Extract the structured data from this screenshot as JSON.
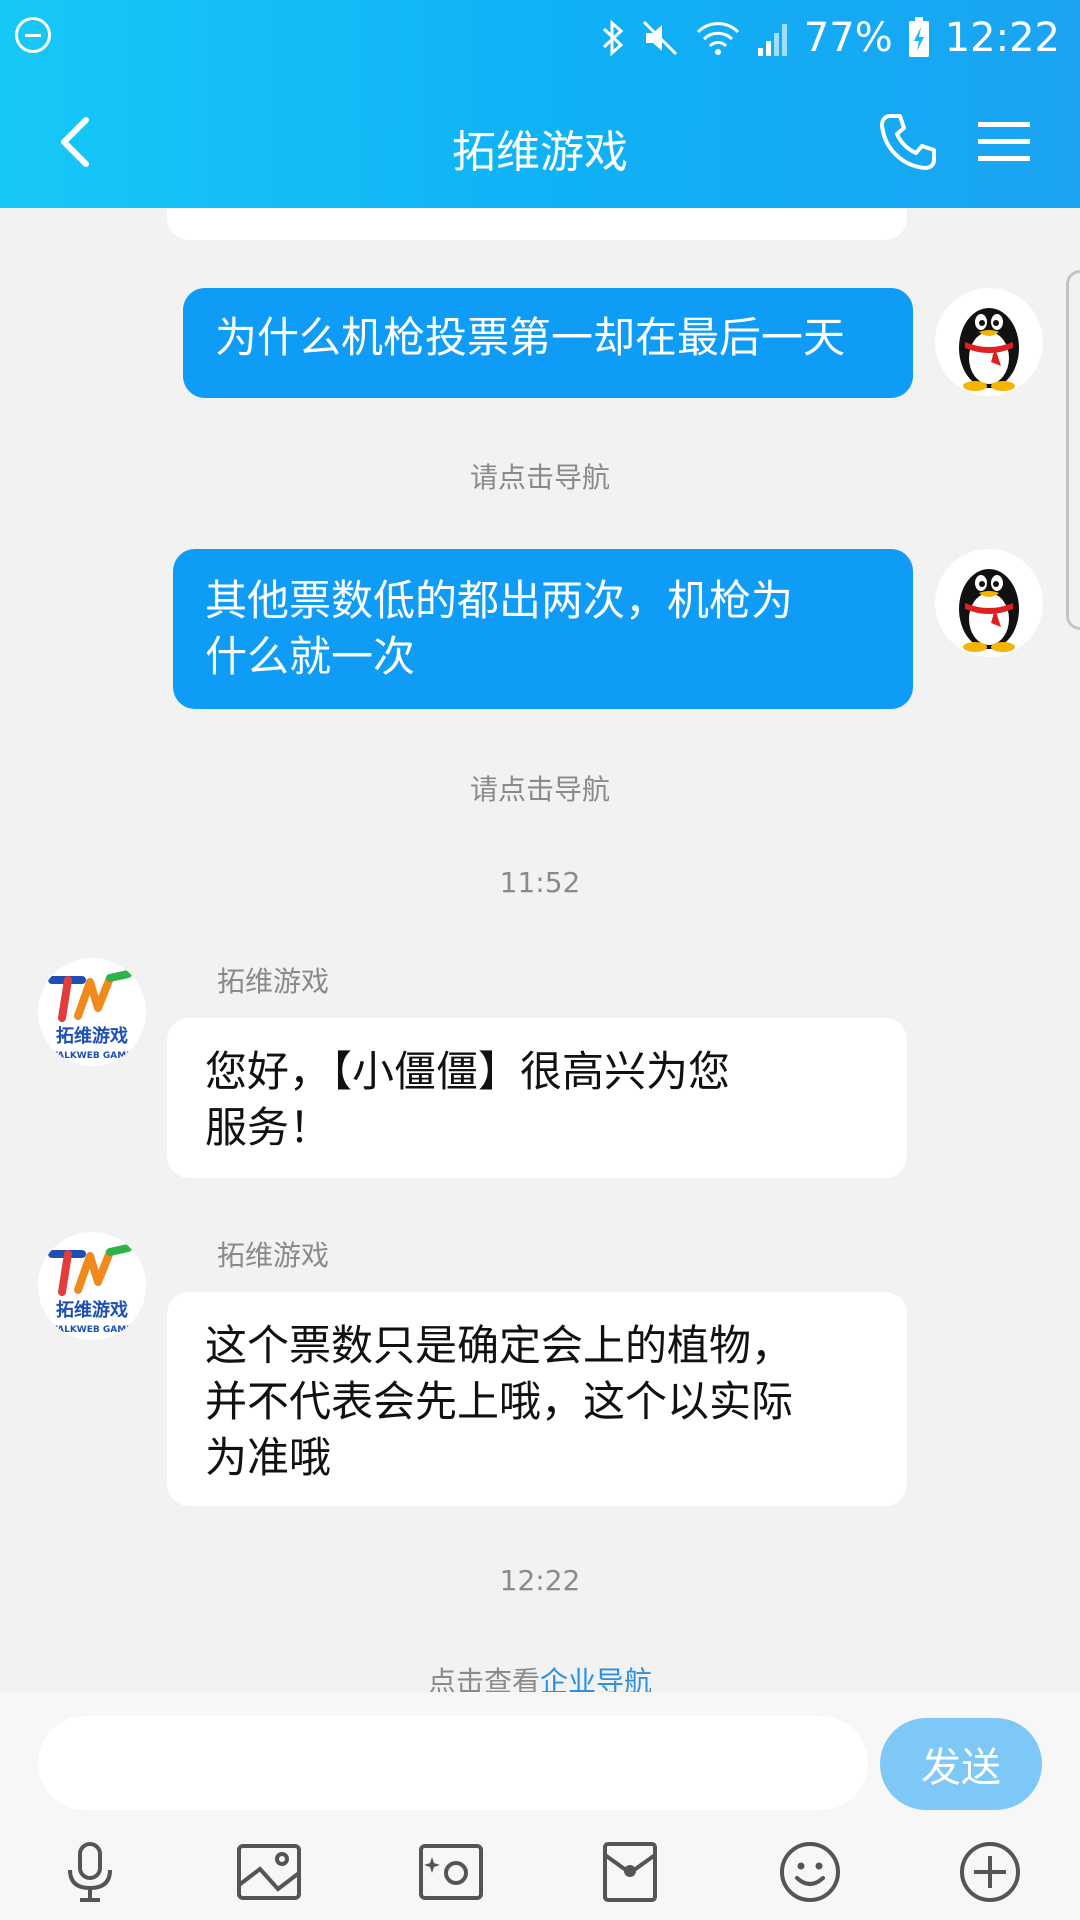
{
  "status_bar": {
    "battery": "77%",
    "time": "12:22",
    "icons": [
      "do-not-disturb-icon",
      "bluetooth-icon",
      "mute-icon",
      "wifi-icon",
      "signal-icon",
      "battery-charging-icon"
    ]
  },
  "header": {
    "title": "拓维游戏",
    "back_icon": "chevron-left-icon",
    "call_icon": "phone-icon",
    "menu_icon": "hamburger-menu-icon"
  },
  "messages": {
    "out1": {
      "text": "为什么机枪投票第一却在最后一天"
    },
    "sys1": "请点击导航",
    "out2": {
      "text": "其他票数低的都出两次，机枪为什么就一次"
    },
    "sys2": "请点击导航",
    "time1": "11:52",
    "in1": {
      "sender": "拓维游戏",
      "text": "您好，【小僵僵】很高兴为您服务！"
    },
    "in2": {
      "sender": "拓维游戏",
      "text": "这个票数只是确定会上的植物，并不代表会先上哦，这个以实际为准哦"
    },
    "time2": "12:22",
    "nav_prefix": "点击查看",
    "nav_link": "企业导航"
  },
  "avatars": {
    "user_icon": "qq-penguin-avatar",
    "company_logo_text": "拓维游戏",
    "company_logo_sub": "TALKWEB GAME"
  },
  "input": {
    "placeholder": "",
    "value": "",
    "send_label": "发送"
  },
  "toolbar": {
    "icons": [
      "microphone-icon",
      "image-icon",
      "camera-icon",
      "red-packet-icon",
      "emoji-icon",
      "add-icon"
    ]
  },
  "colors": {
    "header_accent": "#16c8f7",
    "outgoing_bubble": "#0f9cf6",
    "send_button": "#7ec8f7",
    "link": "#2f91dc"
  }
}
